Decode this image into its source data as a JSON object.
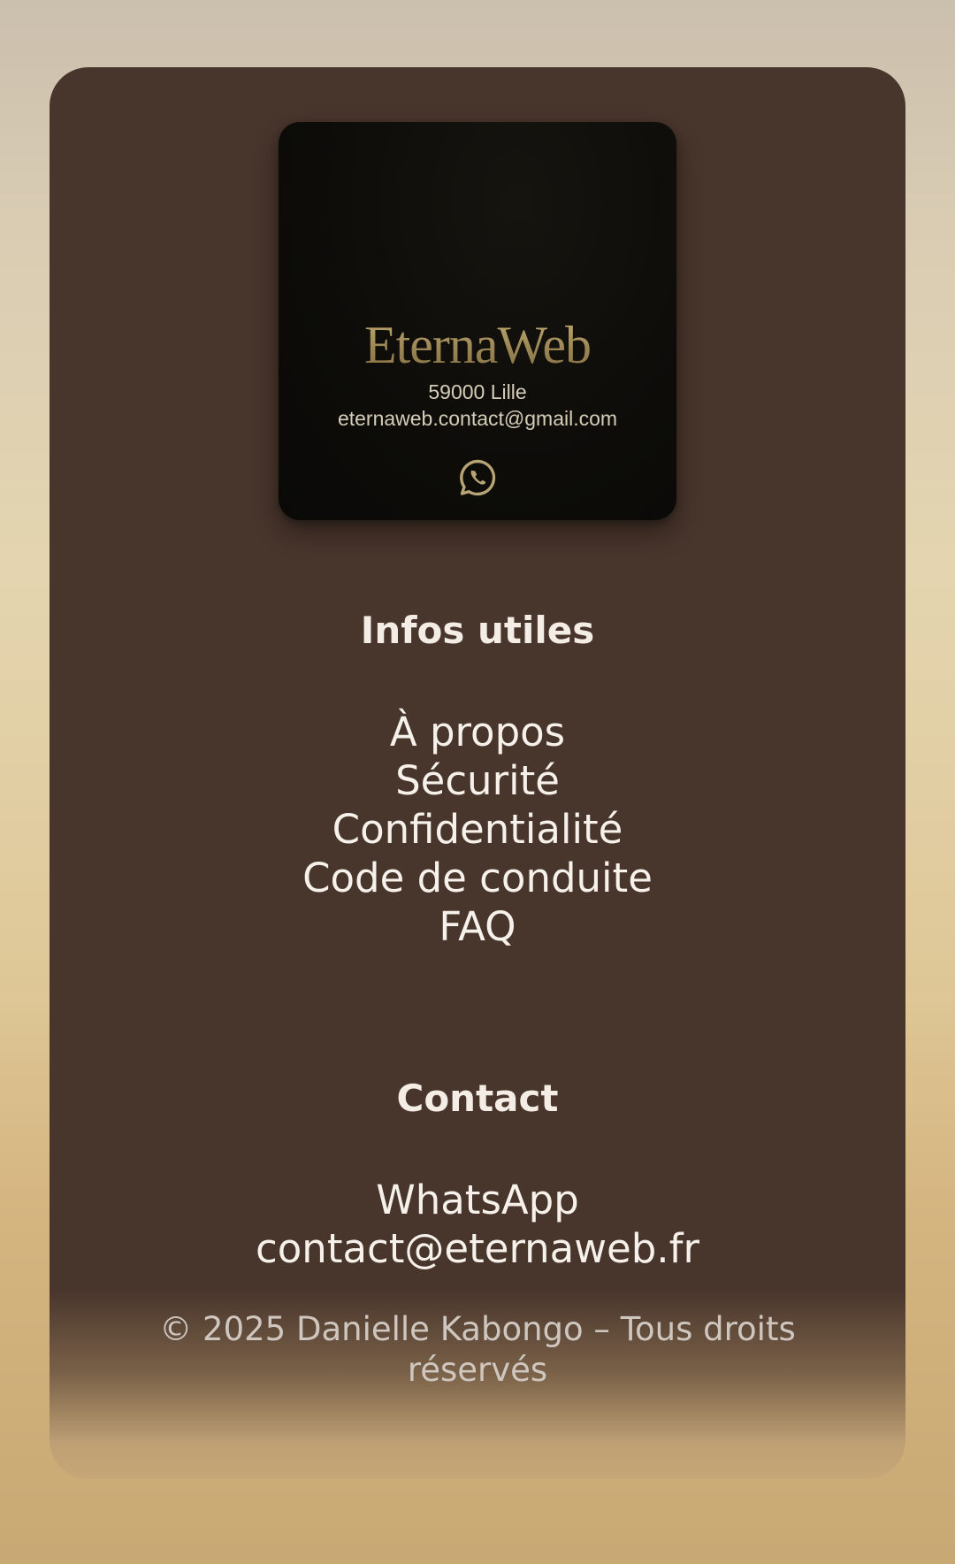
{
  "colors": {
    "card_background": "#48352c",
    "brand_gold": "#a8925e",
    "text_light": "#f6f1ea",
    "page_background": "#e4d5b0"
  },
  "brand": {
    "logo_icon": "golden-vertical-lines-logo-icon",
    "name": "EternaWeb",
    "address": "59000 Lille",
    "email": "eternaweb.contact@gmail.com",
    "whatsapp_icon": "whatsapp-icon"
  },
  "infos": {
    "title": "Infos utiles",
    "links": [
      "À propos",
      "Sécurité",
      "Confidentialité",
      "Code de conduite",
      "FAQ"
    ]
  },
  "contact": {
    "title": "Contact",
    "links": [
      "WhatsApp",
      "contact@eternaweb.fr"
    ]
  },
  "copyright": "© 2025 Danielle Kabongo – Tous droits réservés"
}
